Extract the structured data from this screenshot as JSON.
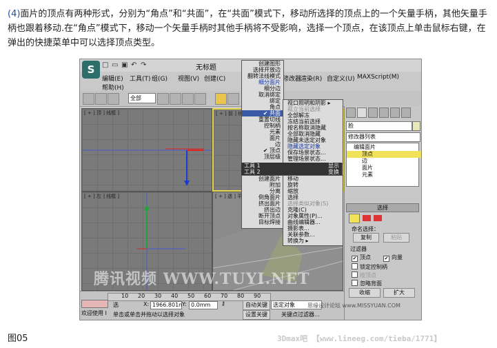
{
  "paragraph": {
    "num": "(4)",
    "text": "面片的顶点有两种形式，分别为“角点”和“共面”，在“共面”模式下，移动所选择的顶点上的一个矢量手柄，其他矢量手柄也跟着移动.在“角点”模式下，移动一个矢量手柄时其他手柄将不受影响，选择一个顶点，在该顶点上单击鼠标右键，在弹出的快捷菜单中可以选择顶点类型。"
  },
  "caption": "图05",
  "bottom_watermark": "3Dmax吧  【www.lineeg.com/tieba/1771】",
  "window": {
    "logo": "S",
    "title": "无标题",
    "menus": [
      "编辑(E)",
      "工具(T)",
      "组(G)",
      "视图(V)",
      "创建(C)",
      "修改器",
      "渲染(R)",
      "自定义(U)",
      "MAXScript(M)",
      "帮助(H)"
    ],
    "toolbar_select": "全部",
    "viewports": {
      "top": "[ + ] 顶 ] 线框 ]",
      "front": "[ + ] 前 ] 线框 ]",
      "left": "[ + ] 左 ] 线框 ]",
      "persp": "[ + ] 透 ] 平"
    },
    "watermark": "腾讯视频 WWW.TUYI.NET",
    "right_watermark": "思缘设计论坛 www.MISSYUAN.COM"
  },
  "command_panel": {
    "name_field": "脸",
    "modifier_list": "修改器列表",
    "stack": [
      {
        "label": "编辑面片",
        "indent": 0,
        "selected": false
      },
      {
        "label": "顶点",
        "indent": 1,
        "selected": true
      },
      {
        "label": "边",
        "indent": 1,
        "selected": false
      },
      {
        "label": "面片",
        "indent": 1,
        "selected": false
      },
      {
        "label": "元素",
        "indent": 1,
        "selected": false
      }
    ],
    "rollout_select": "选择",
    "named_sel": "命名选择：",
    "copy_btn": "复制",
    "paste_btn": "粘贴",
    "filter": "过滤器",
    "chk_vertex": "顶点",
    "chk_vector": "向量",
    "chk_lock": "锁定控制柄",
    "chk_byvertex": "按顶点",
    "chk_ignore": "忽略背面",
    "shrink": "收缩",
    "grow": "扩大"
  },
  "quad_left_top": [
    {
      "label": "创建图形",
      "style": ""
    },
    {
      "label": "选择开放边",
      "style": ""
    },
    {
      "label": "翻转法线模式",
      "style": ""
    },
    {
      "label": "细分面片",
      "style": "blue"
    },
    {
      "label": "细分边",
      "style": ""
    },
    {
      "label": "取消绑定",
      "style": ""
    },
    {
      "label": "绑定",
      "style": ""
    },
    {
      "label": "角点",
      "style": ""
    },
    {
      "label": "共面",
      "style": "hi",
      "check": "✔"
    },
    {
      "label": "重置切线",
      "style": ""
    },
    {
      "label": "控制柄",
      "style": ""
    },
    {
      "label": "元素",
      "style": ""
    },
    {
      "label": "面片",
      "style": ""
    },
    {
      "label": "边",
      "style": ""
    },
    {
      "label": "顶点",
      "style": "",
      "check": "✔"
    },
    {
      "label": "顶层级",
      "style": ""
    }
  ],
  "quad_right_top": [
    {
      "label": "视口照明和阴影 ▸",
      "style": ""
    },
    {
      "label": "孤立当前选择",
      "style": "dim"
    },
    {
      "label": "全部解冻",
      "style": ""
    },
    {
      "label": "冻结当前选择",
      "style": ""
    },
    {
      "label": "按名称取消隐藏",
      "style": ""
    },
    {
      "label": "全部取消隐藏",
      "style": ""
    },
    {
      "label": "隐藏未选定对象",
      "style": ""
    },
    {
      "label": "隐藏选定对象",
      "style": "blue"
    },
    {
      "label": "保存场景状态...",
      "style": ""
    },
    {
      "label": "管理场景状态...",
      "style": ""
    }
  ],
  "quad_head_left": "工具 1",
  "quad_head_right": "显示",
  "quad_head_left2": "工具 2",
  "quad_head_right2": "变换",
  "quad_left_bottom": [
    {
      "label": "创建面片",
      "style": ""
    },
    {
      "label": "附加",
      "style": ""
    },
    {
      "label": "分离",
      "style": ""
    },
    {
      "label": "倒角面片",
      "style": ""
    },
    {
      "label": "挤出面片",
      "style": ""
    },
    {
      "label": "挤出边",
      "style": ""
    },
    {
      "label": "断开顶点",
      "style": ""
    },
    {
      "label": "目标焊接",
      "style": ""
    }
  ],
  "quad_right_bottom": [
    {
      "label": "移动",
      "style": ""
    },
    {
      "label": "旋转",
      "style": ""
    },
    {
      "label": "缩放",
      "style": ""
    },
    {
      "label": "选择",
      "style": ""
    },
    {
      "label": "选择类似对象(S)",
      "style": "dim"
    },
    {
      "label": "克隆(C)",
      "style": ""
    },
    {
      "label": "对象属性(P)...",
      "style": ""
    },
    {
      "label": "曲线编辑器...",
      "style": ""
    },
    {
      "label": "摄影表...",
      "style": ""
    },
    {
      "label": "关联参数...",
      "style": ""
    },
    {
      "label": "转换为 ▸",
      "style": ""
    }
  ],
  "status": {
    "welcome": "欢迎使用 I",
    "selected": "选",
    "x_label": "X:",
    "x_val": "1966.801n",
    "y_label": "Y:",
    "y_val": "0.0mm",
    "auto_key": "自动关键点",
    "sel_obj": "选定对象",
    "set_key": "设置关键点",
    "key_filter": "关键点过滤器...",
    "prompt": "单击或单击并拖动以选择对象",
    "ticks": [
      "10",
      "20",
      "30",
      "40",
      "50",
      "60",
      "70",
      "80",
      "90"
    ]
  },
  "colors": {
    "active_border": "#e6d64a",
    "highlight": "#3a5aa8",
    "axis_red": "#d22",
    "axis_blue": "#1a3ad0",
    "axis_green": "#1fa33a"
  }
}
